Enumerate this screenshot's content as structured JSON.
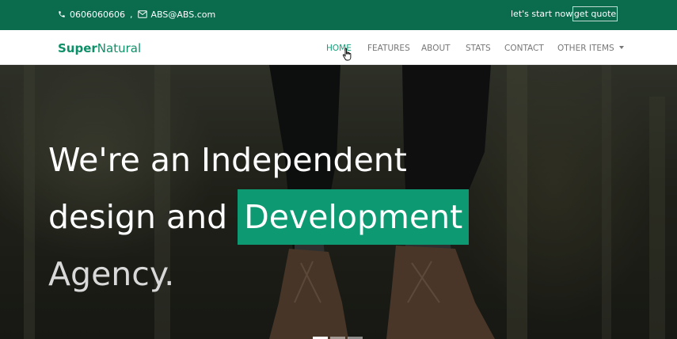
{
  "topbar": {
    "phone": "0606060606",
    "separator": ",",
    "email": "ABS@ABS.com",
    "start_link": "let's start now",
    "quote_button": "get quote",
    "background": "#0a6b4d"
  },
  "brand": {
    "part1": "Super",
    "part2": "Natural",
    "color": "#0f8f67"
  },
  "nav": {
    "items": [
      {
        "label": "HOME",
        "active": true
      },
      {
        "label": "FEATURES",
        "active": false
      },
      {
        "label": "ABOUT",
        "active": false
      },
      {
        "label": "STATS",
        "active": false
      },
      {
        "label": "CONTACT",
        "active": false
      },
      {
        "label": "OTHER ITEMS",
        "active": false,
        "dropdown": true
      }
    ],
    "active_color": "#12a07a"
  },
  "hero": {
    "line1": "We're an Independent",
    "line2_prefix": "design and",
    "line2_highlight": "Development",
    "line3": "Agency.",
    "highlight_color": "#0d9a73",
    "carousel": {
      "slides": 3,
      "active_index": 0
    }
  },
  "icons": [
    "phone-icon",
    "envelope-icon",
    "chevron-down-icon",
    "hand-cursor-icon"
  ]
}
